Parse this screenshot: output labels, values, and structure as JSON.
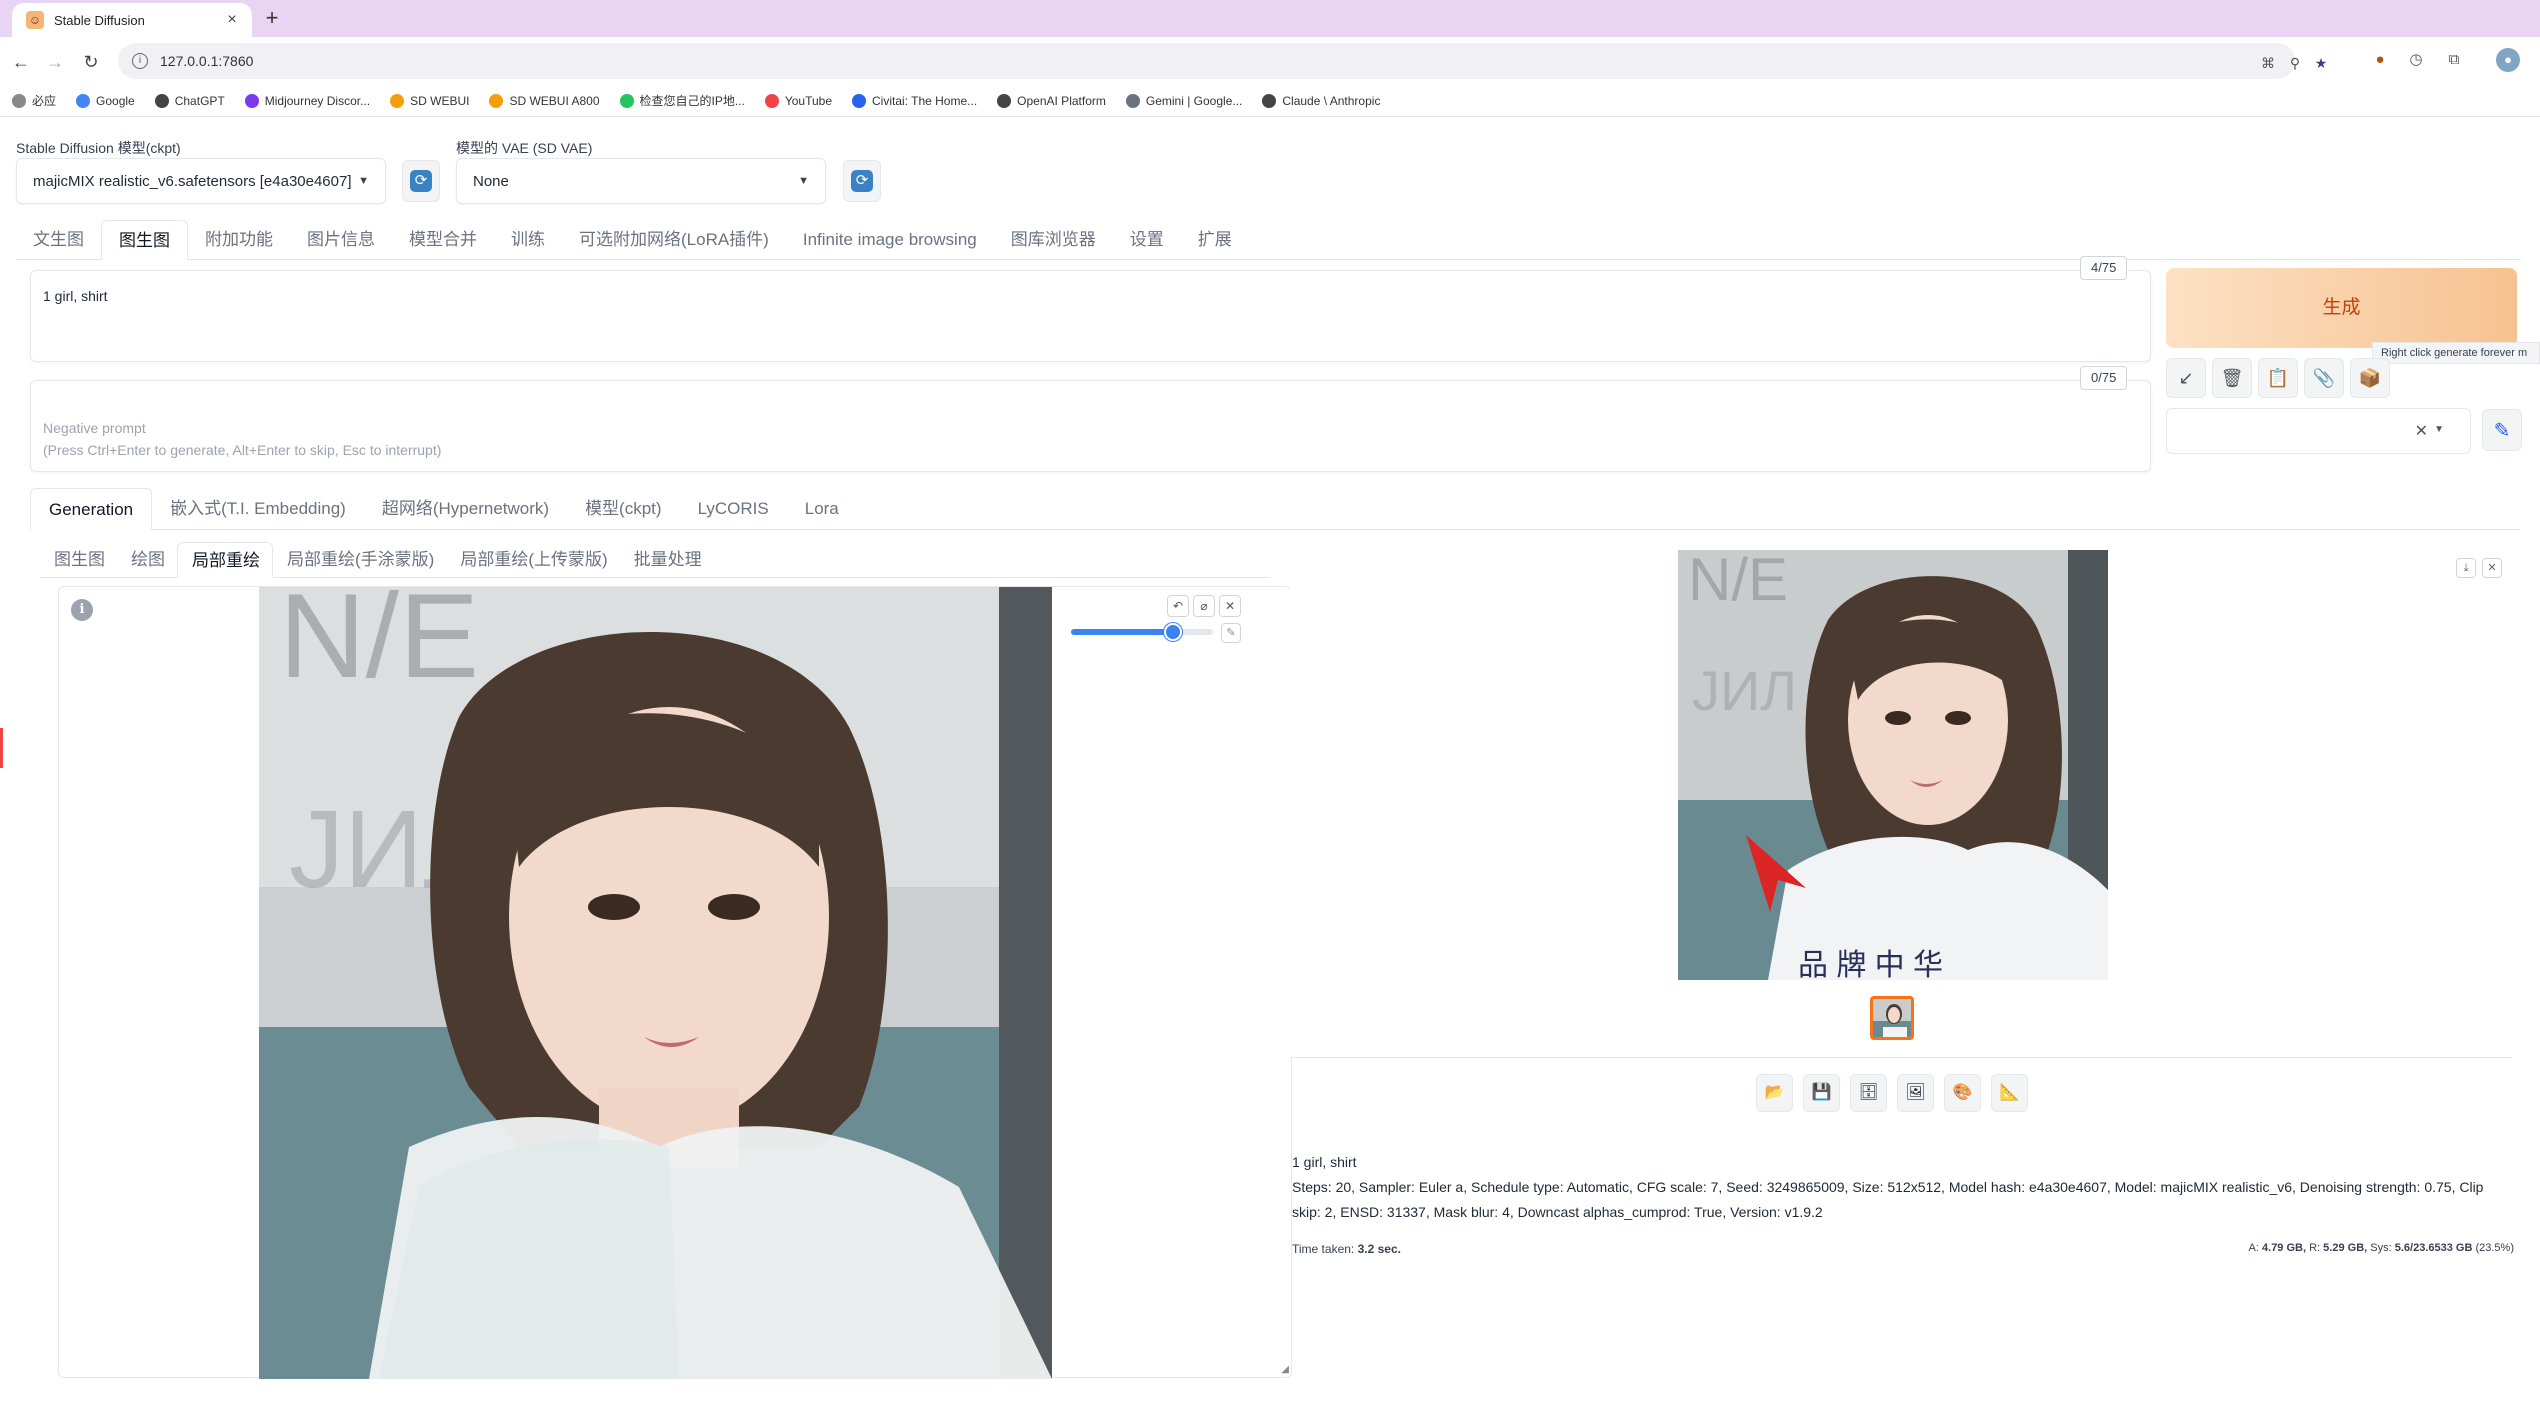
{
  "browser": {
    "tab_title": "Stable Diffusion",
    "new_tab": "+",
    "url": "127.0.0.1:7860",
    "bookmarks": [
      {
        "label": "必应",
        "color": "#888888"
      },
      {
        "label": "Google",
        "color": "#4285f4"
      },
      {
        "label": "ChatGPT",
        "color": "#444444"
      },
      {
        "label": "Midjourney Discor...",
        "color": "#7c3aed"
      },
      {
        "label": "SD WEBUI",
        "color": "#f59e0b"
      },
      {
        "label": "SD WEBUI A800",
        "color": "#f59e0b"
      },
      {
        "label": "检查您自己的IP地...",
        "color": "#22c55e"
      },
      {
        "label": "YouTube",
        "color": "#ef4444"
      },
      {
        "label": "Civitai: The Home...",
        "color": "#2563eb"
      },
      {
        "label": "OpenAI Platform",
        "color": "#444444"
      },
      {
        "label": "Gemini | Google...",
        "color": "#6b7280"
      },
      {
        "label": "Claude \\ Anthropic",
        "color": "#444444"
      }
    ]
  },
  "app": {
    "ckpt_label": "Stable Diffusion 模型(ckpt)",
    "ckpt_value": "majicMIX realistic_v6.safetensors [e4a30e4607]",
    "vae_label": "模型的 VAE (SD VAE)",
    "vae_value": "None",
    "main_tabs": [
      "文生图",
      "图生图",
      "附加功能",
      "图片信息",
      "模型合并",
      "训练",
      "可选附加网络(LoRA插件)",
      "Infinite image browsing",
      "图库浏览器",
      "设置",
      "扩展"
    ],
    "prompt": "1 girl, shirt",
    "prompt_count": "4/75",
    "negative_placeholder": "Negative prompt\n(Press Ctrl+Enter to generate, Alt+Enter to skip, Esc to interrupt)",
    "negative_count": "0/75",
    "generate_label": "生成",
    "generate_tooltip": "Right click generate forever m",
    "gen_tabs": [
      "Generation",
      "嵌入式(T.I. Embedding)",
      "超网络(Hypernetwork)",
      "模型(ckpt)",
      "LyCORIS",
      "Lora"
    ],
    "sub_tabs": [
      "图生图",
      "绘图",
      "局部重绘",
      "局部重绘(手涂蒙版)",
      "局部重绘(上传蒙版)",
      "批量处理"
    ],
    "brush_size_fraction": 0.72,
    "output_caption": "1 girl, shirt",
    "output_params": "Steps: 20, Sampler: Euler a, Schedule type: Automatic, CFG scale: 7, Seed: 3249865009, Size: 512x512, Model hash: e4a30e4607, Model: majicMIX realistic_v6, Denoising strength: 0.75, Clip skip: 2, ENSD: 31337, Mask blur: 4, Downcast alphas_cumprod: True, Version: v1.9.2",
    "time_label": "Time taken:",
    "time_value": "3.2 sec.",
    "mem_a_label": "A:",
    "mem_a": "4.79 GB,",
    "mem_r_label": "R:",
    "mem_r": "5.29 GB,",
    "mem_sys_label": "Sys:",
    "mem_sys": "5.6/23.6533 GB",
    "mem_pct": "(23.5%)"
  },
  "colors": {
    "accent": "#3b82f6",
    "generate_text": "#c2410c",
    "tab_strip": "#e9d5f3"
  }
}
